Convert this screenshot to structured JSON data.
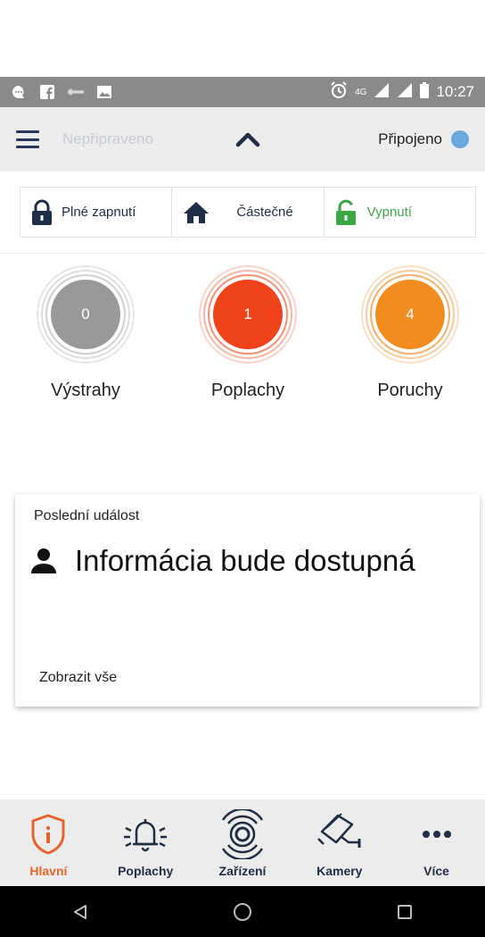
{
  "status_bar": {
    "time": "10:27",
    "network": "4G",
    "icons": [
      "chat-icon",
      "facebook-icon",
      "banking-icon",
      "image-icon",
      "alarm-clock-icon",
      "signal-icon",
      "battery-icon"
    ]
  },
  "app_bar": {
    "status_text": "Nepřipraveno",
    "connection_label": "Připojeno",
    "connection_color": "#6aa9de"
  },
  "arm_buttons": [
    {
      "label": "Plné zapnutí",
      "icon": "lock-closed-icon",
      "color": "#1f2d46"
    },
    {
      "label": "Částečné",
      "icon": "home-icon",
      "color": "#1f2d46"
    },
    {
      "label": "Vypnutí",
      "icon": "lock-open-icon",
      "color": "#3aa845"
    }
  ],
  "counters": [
    {
      "label": "Výstrahy",
      "value": "0",
      "color": "#999999"
    },
    {
      "label": "Poplachy",
      "value": "1",
      "color": "#f0431c"
    },
    {
      "label": "Poruchy",
      "value": "4",
      "color": "#f28c1e"
    }
  ],
  "last_event": {
    "title": "Poslední událost",
    "info": "Informácia bude dostupná",
    "view_all": "Zobrazit vše"
  },
  "bottom_nav": [
    {
      "label": "Hlavní",
      "icon": "info-shield-icon",
      "active": true
    },
    {
      "label": "Poplachy",
      "icon": "bell-icon",
      "active": false
    },
    {
      "label": "Zařízení",
      "icon": "sensor-icon",
      "active": false
    },
    {
      "label": "Kamery",
      "icon": "camera-icon",
      "active": false
    },
    {
      "label": "Více",
      "icon": "more-icon",
      "active": false
    }
  ],
  "colors": {
    "accent": "#e8632b",
    "navy": "#1f2d46"
  }
}
